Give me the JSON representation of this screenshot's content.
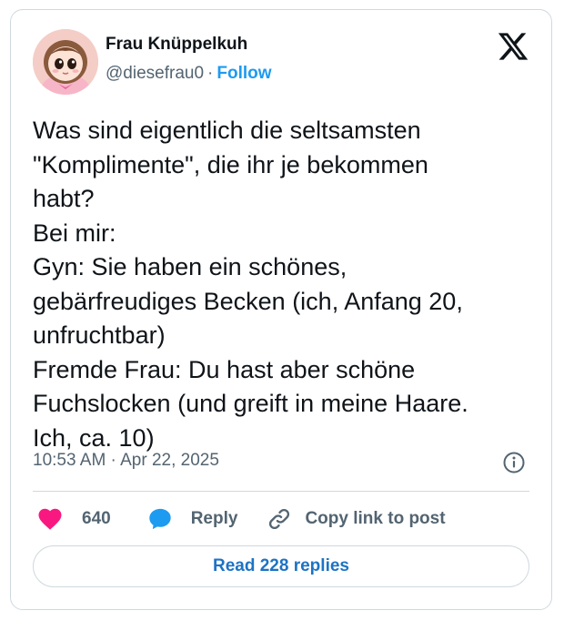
{
  "author": {
    "name": "Frau Knüppelkuh",
    "handle": "@diesefrau0",
    "separator": "·",
    "follow_label": "Follow"
  },
  "logo": {
    "icon": "x-logo-icon"
  },
  "tweet": {
    "lines": [
      "Was sind eigentlich die seltsamsten",
      "\"Komplimente\", die ihr je bekommen",
      "habt?",
      "Bei mir:",
      "Gyn: Sie haben ein schönes,",
      "gebärfreudiges Becken (ich, Anfang 20,",
      "unfruchtbar)",
      "Fremde Frau: Du hast aber schöne",
      "Fuchslocken (und greift in meine Haare.",
      "Ich, ca. 10)"
    ],
    "timestamp": "10:53 AM · Apr 22, 2025"
  },
  "actions": {
    "like_count": "640",
    "reply_label": "Reply",
    "copy_link_label": "Copy link to post"
  },
  "read_replies_label": "Read 228 replies",
  "colors": {
    "like": "#f91880",
    "reply": "#1d9bf0",
    "follow": "#1d9bf0",
    "border": "#cfd9de",
    "secondary_text": "#536471"
  }
}
